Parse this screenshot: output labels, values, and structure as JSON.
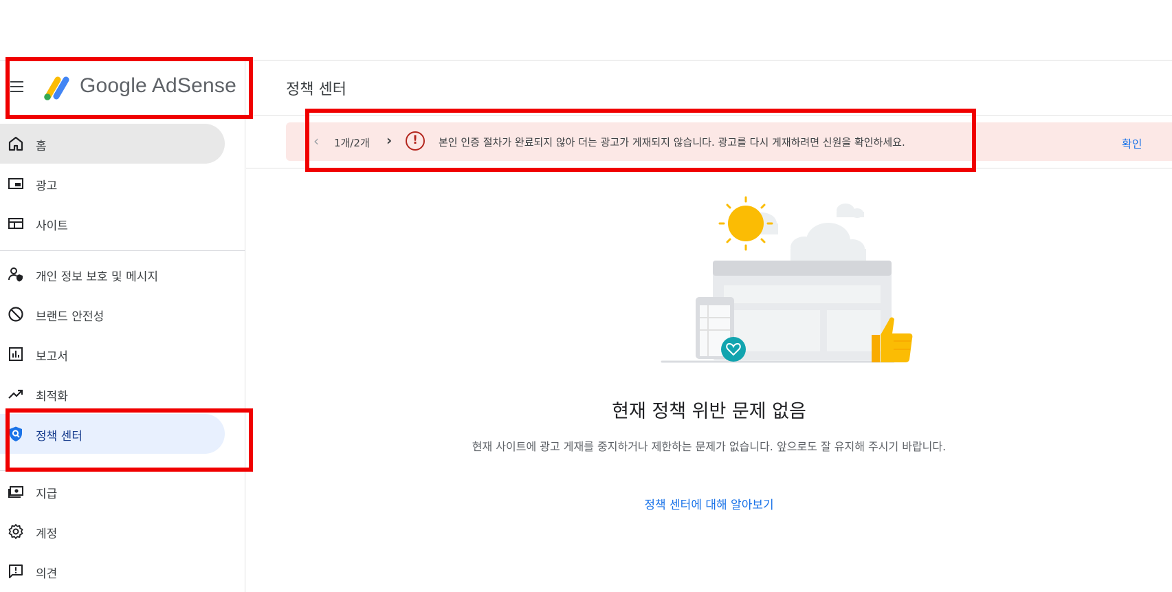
{
  "app": {
    "brand_name": "Google AdSense",
    "page_title": "정책 센터"
  },
  "sidebar": {
    "items": [
      {
        "label": "홈",
        "icon": "home-icon"
      },
      {
        "label": "광고",
        "icon": "ads-icon"
      },
      {
        "label": "사이트",
        "icon": "sites-icon"
      },
      {
        "label": "개인 정보 보호 및 메시지",
        "icon": "privacy-messaging-icon"
      },
      {
        "label": "브랜드 안전성",
        "icon": "block-icon"
      },
      {
        "label": "보고서",
        "icon": "reports-icon"
      },
      {
        "label": "최적화",
        "icon": "trending-up-icon"
      },
      {
        "label": "정책 센터",
        "icon": "policy-shield-icon"
      },
      {
        "label": "지급",
        "icon": "payments-icon"
      },
      {
        "label": "계정",
        "icon": "gear-icon"
      },
      {
        "label": "의견",
        "icon": "feedback-icon"
      }
    ],
    "active_item": "정책 센터"
  },
  "banner": {
    "counter": "1개/2개",
    "message": "본인 인증 절차가 완료되지 않아 더는 광고가 게재되지 않습니다. 광고를 다시 게재하려면 신원을 확인하세요.",
    "action_label": "확인",
    "alert_glyph": "!",
    "prev_glyph": "‹",
    "next_glyph": "›",
    "background_color": "#fce8e6",
    "alert_color": "#b3261e"
  },
  "empty_state": {
    "title": "현재 정책 위반 문제 없음",
    "description": "현재 사이트에 광고 게재를 중지하거나 제한하는 문제가 없습니다. 앞으로도 잘 유지해 주시기 바랍니다.",
    "link_label": "정책 센터에 대해 알아보기"
  },
  "colors": {
    "accent": "#1a73e8",
    "highlight_box": "#f00000",
    "active_nav_bg": "#e8f0fe",
    "home_nav_bg": "#e8e8e8"
  }
}
